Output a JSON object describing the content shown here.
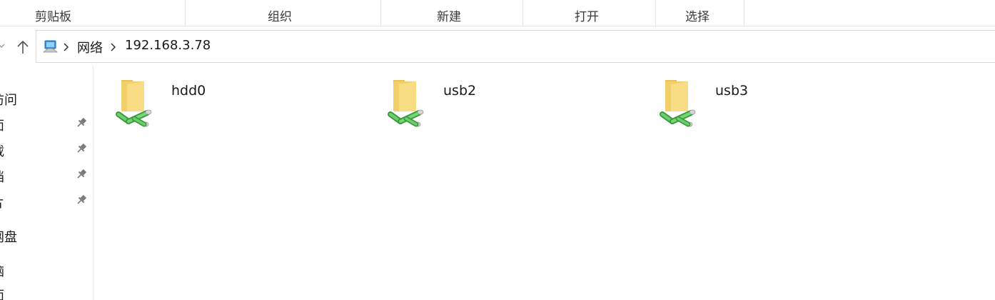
{
  "ribbon": {
    "groups": [
      {
        "label": "剪贴板"
      },
      {
        "label": "组织"
      },
      {
        "label": "新建"
      },
      {
        "label": "打开"
      },
      {
        "label": "选择"
      }
    ]
  },
  "navigation": {
    "path": [
      "网络",
      "192.168.3.78"
    ],
    "location_icon": "network-computer-icon"
  },
  "sidebar": {
    "items": [
      {
        "label": "访问",
        "pinned": false
      },
      {
        "label": "面",
        "pinned": true
      },
      {
        "label": "载",
        "pinned": true
      },
      {
        "label": "档",
        "pinned": true
      },
      {
        "label": "片",
        "pinned": true
      },
      {
        "label": "网盘",
        "pinned": false
      },
      {
        "label": "脑",
        "pinned": false
      },
      {
        "label": "面",
        "pinned": false
      }
    ]
  },
  "content": {
    "items": [
      {
        "name": "hdd0",
        "icon": "network-share-folder-icon"
      },
      {
        "name": "usb2",
        "icon": "network-share-folder-icon"
      },
      {
        "name": "usb3",
        "icon": "network-share-folder-icon"
      }
    ]
  },
  "colors": {
    "folder": "#f6d66f",
    "network_pipe": "#4caf50",
    "accent": "#0078d4"
  }
}
